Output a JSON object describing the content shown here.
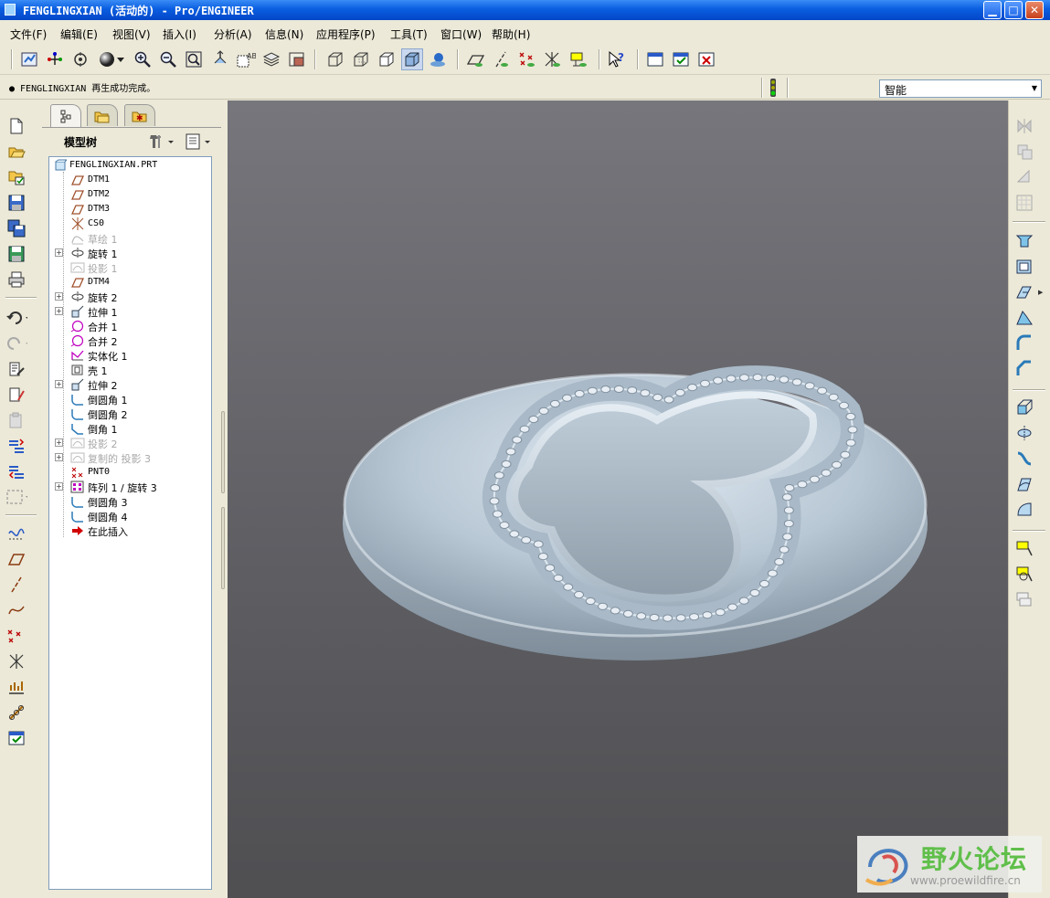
{
  "window": {
    "title": "FENGLINGXIAN (活动的) - Pro/ENGINEER",
    "minimize_label": "▁",
    "maximize_label": "□",
    "close_label": "✕"
  },
  "menubar": {
    "items": [
      "文件(F)",
      "编辑(E)",
      "视图(V)",
      "插入(I)",
      "分析(A)",
      "信息(N)",
      "应用程序(P)",
      "工具(T)",
      "窗口(W)",
      "帮助(H)"
    ]
  },
  "message": {
    "text": "● FENGLINGXIAN 再生成功完成。"
  },
  "filter": {
    "selected": "智能"
  },
  "navigator": {
    "title": "模型树",
    "tree": [
      {
        "label": "FENGLINGXIAN.PRT",
        "icon": "part-icon",
        "root": true
      },
      {
        "label": "DTM1",
        "icon": "datum-plane-icon"
      },
      {
        "label": "DTM2",
        "icon": "datum-plane-icon"
      },
      {
        "label": "DTM3",
        "icon": "datum-plane-icon"
      },
      {
        "label": "CS0",
        "icon": "coordinate-system-icon"
      },
      {
        "label": "草绘 1",
        "icon": "sketch-icon",
        "dim": true
      },
      {
        "label": "旋转 1",
        "icon": "revolve-icon",
        "expandable": true
      },
      {
        "label": "投影 1",
        "icon": "projection-icon",
        "dim": true
      },
      {
        "label": "DTM4",
        "icon": "datum-plane-icon"
      },
      {
        "label": "旋转 2",
        "icon": "revolve-icon",
        "expandable": true
      },
      {
        "label": "拉伸 1",
        "icon": "extrude-icon",
        "expandable": true
      },
      {
        "label": "合并 1",
        "icon": "merge-icon"
      },
      {
        "label": "合并 2",
        "icon": "merge-icon"
      },
      {
        "label": "实体化 1",
        "icon": "solidify-icon"
      },
      {
        "label": "壳 1",
        "icon": "shell-icon"
      },
      {
        "label": "拉伸 2",
        "icon": "extrude-icon",
        "expandable": true
      },
      {
        "label": "倒圆角 1",
        "icon": "round-icon"
      },
      {
        "label": "倒圆角 2",
        "icon": "round-icon"
      },
      {
        "label": "倒角 1",
        "icon": "chamfer-icon"
      },
      {
        "label": "投影 2",
        "icon": "projection-icon",
        "dim": true,
        "expandable": true
      },
      {
        "label": "复制的 投影 3",
        "icon": "projection-icon",
        "dim": true,
        "expandable": true
      },
      {
        "label": "PNT0",
        "icon": "datum-point-icon"
      },
      {
        "label": "阵列 1 / 旋转 3",
        "icon": "pattern-icon",
        "expandable": true
      },
      {
        "label": "倒圆角 3",
        "icon": "round-icon"
      },
      {
        "label": "倒圆角 4",
        "icon": "round-icon"
      },
      {
        "label": "在此插入",
        "icon": "insert-here-arrow-icon"
      }
    ]
  },
  "watermark": {
    "title": "野火论坛",
    "url": "www.proewildfire.cn"
  },
  "colors": {
    "titlebar": "#0a5ee0",
    "viewport_background": "#5f5f64",
    "part_surface": "#b7c6d3",
    "datum_plane": "#a0522d",
    "pattern_highlight": "#c000c0",
    "insert_arrow": "#d00000"
  }
}
